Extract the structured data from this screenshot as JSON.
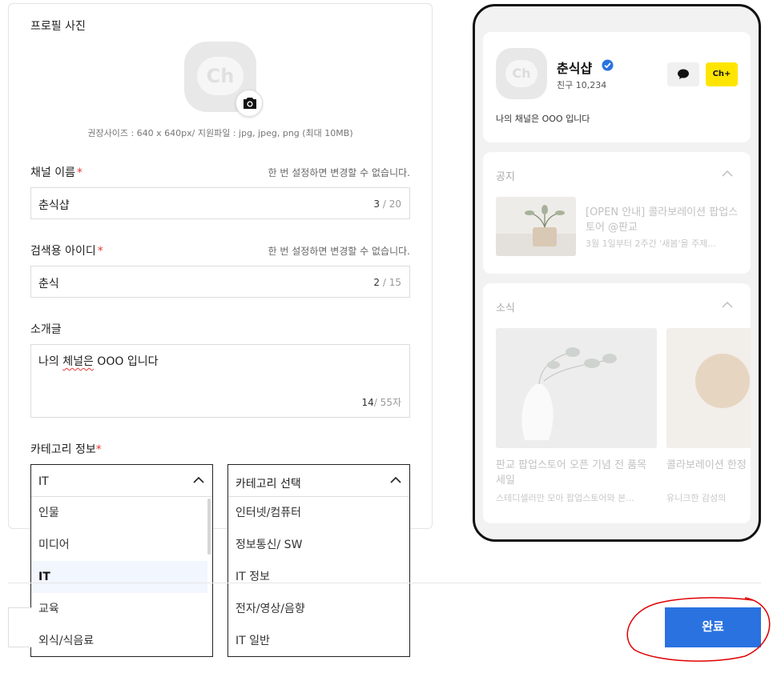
{
  "profile": {
    "photo_label": "프로필 사진",
    "avatar_text": "Ch",
    "size_hint": "권장사이즈 : 640 x 640px/ 지원파일 : jpg, jpeg, png (최대 10MB)"
  },
  "channel_name": {
    "label": "채널 이름",
    "required_mark": "*",
    "hint": "한 번 설정하면 변경할 수 없습니다.",
    "value": "춘식샵",
    "count_current": "3",
    "count_max": " / 20"
  },
  "search_id": {
    "label": "검색용 아이디",
    "required_mark": "*",
    "hint": "한 번 설정하면 변경할 수 없습니다.",
    "value": "춘식",
    "count_current": "2",
    "count_max": " / 15"
  },
  "intro": {
    "label": "소개글",
    "value_pre": "나의 ",
    "value_misspelled": "체널은",
    "value_post": " OOO 입니다",
    "count_current": "14",
    "count_max": "/ 55자"
  },
  "category": {
    "label": "카테고리 정보",
    "required_mark": "*",
    "primary": {
      "selected": "IT",
      "options": [
        "인물",
        "미디어",
        "IT",
        "교육",
        "외식/식음료"
      ],
      "highlighted_index": 2
    },
    "secondary": {
      "placeholder": "카테고리 선택",
      "options": [
        "인터넷/컴퓨터",
        "정보통신/ SW",
        "IT 정보",
        "전자/영상/음향",
        "IT 일반"
      ]
    }
  },
  "actions": {
    "done_label": "완료"
  },
  "preview": {
    "avatar_text": "Ch",
    "name": "춘식샵",
    "friends": "친구 10,234",
    "plus_label": "Ch+",
    "intro": "나의 채널은 OOO 입니다",
    "notice": {
      "section_title": "공지",
      "title": "[OPEN 안내] 콜라보레이션 팝업스토어 @판교",
      "subtitle": "3월 1일부터 2주간 '새봄'을 주제..."
    },
    "news": {
      "section_title": "소식",
      "items": [
        {
          "title": "판교 팝업스토어 오픈 기념 전 품목 세일",
          "subtitle": "스테디셀러만 모아 팝업스토어와 본..."
        },
        {
          "title": "콜라보레이션 한정 출시",
          "subtitle": "유니크한 감성의"
        }
      ]
    }
  },
  "colors": {
    "primary_button": "#2a72e0",
    "required": "#e53935",
    "plus_friend": "#fee500",
    "verified": "#2a72e0",
    "annotation": "#e00000"
  }
}
